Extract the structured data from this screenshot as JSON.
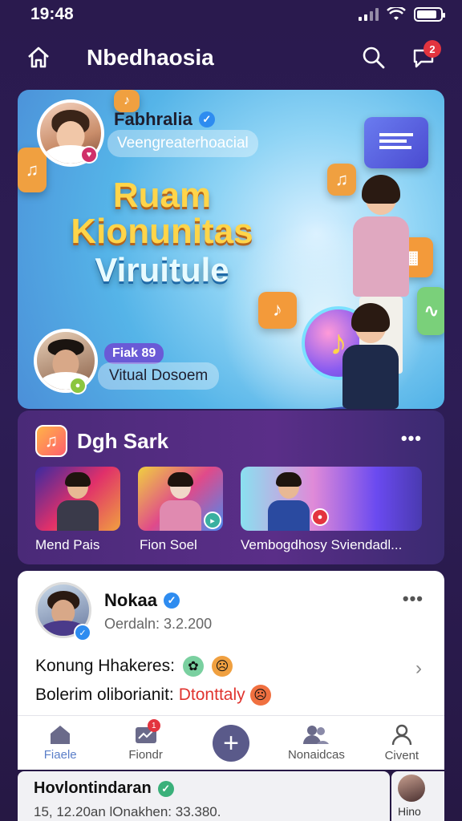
{
  "status": {
    "time": "19:48"
  },
  "header": {
    "title": "Nbedhaosia",
    "notification_count": "2"
  },
  "hero": {
    "profile_name": "Fabhralia",
    "profile_handle": "Veengreaterhoacial",
    "headline_1": "Ruam",
    "headline_2": "Kionunitas",
    "headline_3": "Viruitule",
    "host_tag": "Fiak 89",
    "host_subtitle": "Vitual Dosoem"
  },
  "section": {
    "title": "Dgh Sark",
    "items": [
      {
        "label": "Mend Pais"
      },
      {
        "label": "Fion Soel"
      },
      {
        "label": "Vembogdhosy Sviendadl..."
      }
    ]
  },
  "post": {
    "author": "Nokaa",
    "meta": "Oerdaln: 3.2.200",
    "line1": "Konung Hhakeres:",
    "line2_prefix": "Bolerim oliborianit:",
    "line2_highlight": "Dtonttaly"
  },
  "tabbar": {
    "tabs": [
      {
        "label": "Fiaele"
      },
      {
        "label": "Fiondr",
        "badge": "1"
      },
      {
        "label": ""
      },
      {
        "label": "Nonaidcas"
      },
      {
        "label": "Civent"
      }
    ]
  },
  "next_card": {
    "title": "Hovlontindaran",
    "meta": "15, 12.20an lOnakhen: 33.380.",
    "side_text": "Hino"
  },
  "colors": {
    "accent": "#5a7ec8",
    "badge": "#e3343f",
    "verified": "#2e8cf0"
  }
}
